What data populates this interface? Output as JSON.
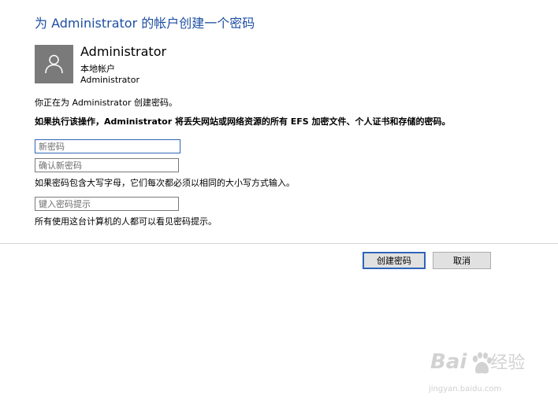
{
  "window": {
    "title": "为 Administrator 的帐户创建一个密码"
  },
  "account": {
    "avatar_icon": "user-icon",
    "name": "Administrator",
    "type": "本地帐户",
    "sub": "Administrator"
  },
  "messages": {
    "intro": "你正在为 Administrator 创建密码。",
    "warning": "如果执行该操作，Administrator 将丢失网站或网络资源的所有 EFS 加密文件、个人证书和存储的密码。",
    "case_note": "如果密码包含大写字母，它们每次都必须以相同的大小写方式输入。",
    "hint_note": "所有使用这台计算机的人都可以看见密码提示。"
  },
  "fields": {
    "new_password": {
      "value": "",
      "placeholder": "新密码"
    },
    "confirm_password": {
      "value": "",
      "placeholder": "确认新密码"
    },
    "password_hint": {
      "value": "",
      "placeholder": "键入密码提示"
    }
  },
  "buttons": {
    "create": "创建密码",
    "cancel": "取消"
  },
  "watermark": {
    "text_left": "Bai",
    "text_right": "经验",
    "url": "jingyan.baidu.com"
  },
  "colors": {
    "title": "#1e4fa3",
    "focus": "#2f65b8",
    "avatar_bg": "#7a7a7a"
  }
}
